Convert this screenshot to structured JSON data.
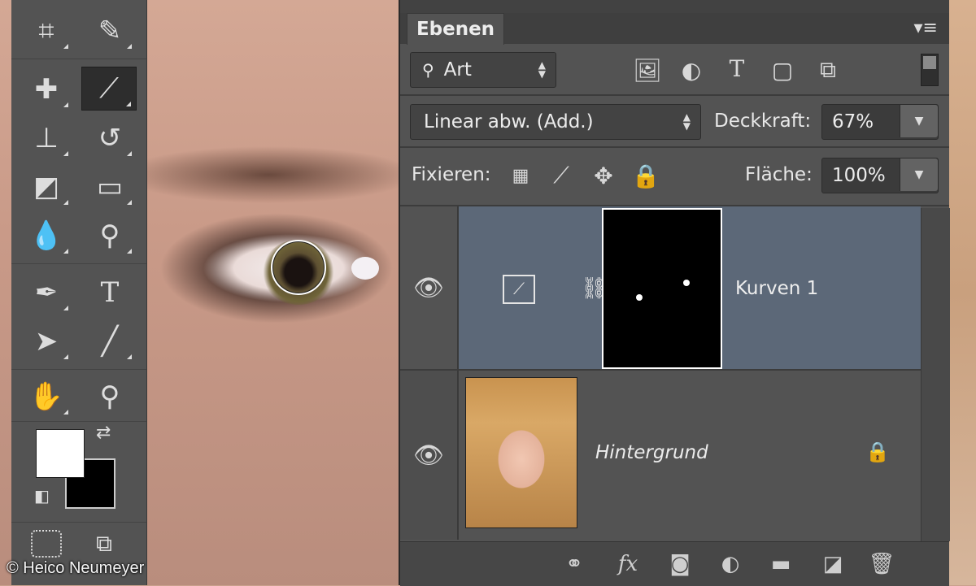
{
  "toolbar": {
    "tools": [
      "crop-tool",
      "eyedropper-tool",
      "healing-brush-tool",
      "brush-tool",
      "clone-stamp-tool",
      "history-brush-tool",
      "eraser-tool",
      "gradient-tool",
      "blur-tool",
      "dodge-tool",
      "pen-tool",
      "type-tool",
      "path-selection-tool",
      "line-tool",
      "hand-tool",
      "zoom-tool"
    ],
    "type_glyph": "T",
    "foreground_color": "#ffffff",
    "background_color": "#000000"
  },
  "panel": {
    "tab_label": "Ebenen",
    "filter": {
      "label": "Art"
    },
    "blend_mode": "Linear abw. (Add.)",
    "opacity": {
      "label": "Deckkraft:",
      "value": "67%"
    },
    "lock": {
      "label": "Fixieren:"
    },
    "fill": {
      "label": "Fläche:",
      "value": "100%"
    },
    "layers": [
      {
        "name": "Kurven 1",
        "visible": true,
        "selected": true,
        "type": "curves-adjustment"
      },
      {
        "name": "Hintergrund",
        "visible": true,
        "selected": false,
        "locked": true
      }
    ],
    "bottom_icons": [
      "link-icon",
      "fx-icon",
      "mask-icon",
      "adjustment-icon",
      "folder-icon",
      "new-layer-icon",
      "trash-icon"
    ],
    "fx_label": "fx"
  },
  "credit": "© Heico Neumeyer"
}
